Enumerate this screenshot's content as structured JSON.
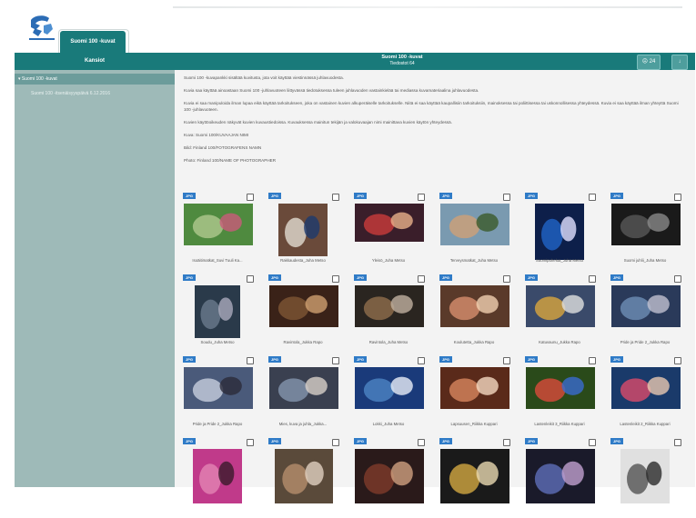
{
  "brand": {
    "tab_label": "Suomi 100 -kuvat"
  },
  "header": {
    "sidebar_title": "Kansiot",
    "title": "Suomi 100 -kuvat",
    "subtitle": "Tiedostot 64",
    "btn1_label": "☹ 24",
    "btn2_label": "↓"
  },
  "sidebar": {
    "items": [
      {
        "label": "▾ Suomi 100 -kuvat"
      },
      {
        "label": "Suomi 100 -itsenäisyyspäivä 6.12.2016"
      }
    ]
  },
  "intro": [
    "Suomi 100 -kuvapankki sisältää kuvitusta, jota voit käyttää viestinnässä juhlavuodesta.",
    "Kuvia saa käyttää ainoastaan Suomi 100 -juhlavuoteen liittyvässä tiedotuksessa tuleen juhlavuoden vastainkielää tai mediassa kuvamateriaalina juhlavuodesta.",
    "Kuvia ei saa manipuloida ilman lupaa eikä käyttää tarkoitukseen, joka on vastainen kuvien alkuperäiselle tarkoitukselle. Niitä ei saa käyttää kaupallisiin tarkoituksiin, mainoksessa tai poliittisessa tai uskonnollisessa yhteydessä. Kuvia ei saa käyttää ilman yhteyttä Suomi 100 -juhlavuoteen.",
    "Kuvien käyttöoikeuden näkyvät kuvien kuvaustiedoissa. Kuvauksessa mainitun tekijän ja valokuvaajan nimi mainittava kuvien käytön yhteydessä.",
    "Kuva: Suomi 100/KUVAAJAN NIMI",
    "Bild: Finland 100/FOTOGRAFENS NAMN",
    "Photo: Finland 100/NAME OF PHOTOGRAPHER"
  ],
  "grid": {
    "badge": "JPG",
    "items": [
      {
        "caption": "Isoäitimatkat_Suvi Tuuli Ka..."
      },
      {
        "caption": "Rakkaudesta_Juha Metso"
      },
      {
        "caption": "Yleisö_Juha Metso"
      },
      {
        "caption": "Terveysmatkat_Juha Metso"
      },
      {
        "caption": "Suomipuhelua_Juha Metso"
      },
      {
        "caption": "Suomi juhlii_Juha Metso"
      },
      {
        "caption": "Soudu_Juha Metso"
      },
      {
        "caption": "Ravintola_Jukka Rapo"
      },
      {
        "caption": "Ravintola_Juha Metso"
      },
      {
        "caption": "Koulutetta_Jukka Rapo"
      },
      {
        "caption": "Katuvaunu_Jukka Rapo"
      },
      {
        "caption": "Pride ja Pride 2_Jukka Rapo"
      },
      {
        "caption": "Pride ja Pride 2_Jukka Rapo"
      },
      {
        "caption": "Mies, kuva ja juhla_Jukka..."
      },
      {
        "caption": "Lokki_Juha Metso"
      },
      {
        "caption": "Lapsuusen_Riikka Kuppari"
      },
      {
        "caption": "Lastenleikit 3_Riikka Kuppari"
      },
      {
        "caption": "Lastenleikit 2_Riikka Kuppari"
      },
      {
        "caption": ""
      },
      {
        "caption": ""
      },
      {
        "caption": ""
      },
      {
        "caption": ""
      },
      {
        "caption": ""
      },
      {
        "caption": ""
      }
    ]
  },
  "colors": {
    "accent": "#197a7a",
    "sidebar": "#9ebab8",
    "badge": "#2f7bc7"
  }
}
